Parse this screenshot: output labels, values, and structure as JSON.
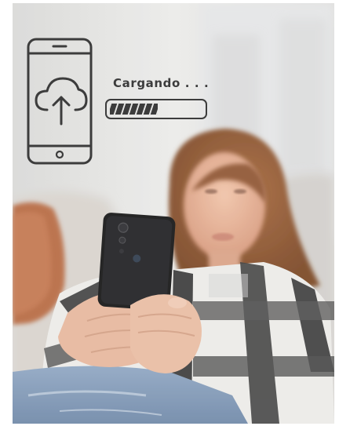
{
  "overlay": {
    "loading_text": "Cargando . . .",
    "progress_fraction": 0.52,
    "icons": {
      "phone": "smartphone-icon",
      "upload": "cloud-upload-icon"
    },
    "ink_color": "#3c3c3c"
  },
  "photo": {
    "subject": "girl-on-couch-using-smartphone"
  }
}
